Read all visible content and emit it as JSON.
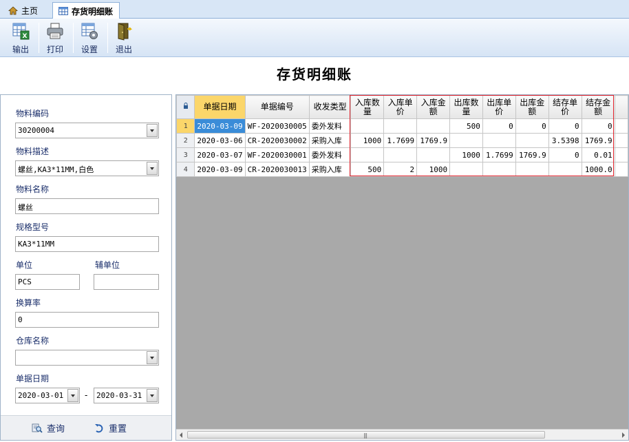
{
  "tabs": [
    {
      "label": "主页",
      "icon": "home-icon"
    },
    {
      "label": "存货明细账",
      "icon": "table-icon"
    }
  ],
  "toolbar": {
    "export_label": "输出",
    "print_label": "打印",
    "settings_label": "设置",
    "exit_label": "退出"
  },
  "report_title": "存货明细账",
  "form": {
    "material_code": {
      "label": "物料编码",
      "value": "30200004"
    },
    "material_desc": {
      "label": "物料描述",
      "value": "螺丝,KA3*11MM,白色"
    },
    "material_name": {
      "label": "物料名称",
      "value": "螺丝"
    },
    "spec_model": {
      "label": "规格型号",
      "value": "KA3*11MM"
    },
    "unit": {
      "label": "单位",
      "value": "PCS"
    },
    "aux_unit": {
      "label": "辅单位",
      "value": ""
    },
    "conversion_rate": {
      "label": "换算率",
      "value": "0"
    },
    "warehouse_name": {
      "label": "仓库名称",
      "value": ""
    },
    "doc_date": {
      "label": "单据日期",
      "from": "2020-03-01",
      "separator": "-",
      "to": "2020-03-31"
    }
  },
  "actions": {
    "query_label": "查询",
    "reset_label": "重置"
  },
  "grid": {
    "columns": [
      "单据日期",
      "单据编号",
      "收发类型",
      "入库数量",
      "入库单价",
      "入库金额",
      "出库数量",
      "出库单价",
      "出库金额",
      "结存单价",
      "结存金额"
    ],
    "column_lines": [
      [
        "单据日期"
      ],
      [
        "单据编号"
      ],
      [
        "收发类型"
      ],
      [
        "入库数",
        "量"
      ],
      [
        "入库单",
        "价"
      ],
      [
        "入库金",
        "额"
      ],
      [
        "出库数",
        "量"
      ],
      [
        "出库单",
        "价"
      ],
      [
        "出库金",
        "额"
      ],
      [
        "结存单",
        "价"
      ],
      [
        "结存金",
        "额"
      ]
    ],
    "rows": [
      {
        "n": "1",
        "cells": [
          "2020-03-09",
          "WF-2020030005",
          "委外发料",
          "",
          "",
          "",
          "500",
          "0",
          "0",
          "0",
          "0"
        ]
      },
      {
        "n": "2",
        "cells": [
          "2020-03-06",
          "CR-2020030002",
          "采购入库",
          "1000",
          "1.7699",
          "1769.9",
          "",
          "",
          "",
          "3.5398",
          "1769.9"
        ]
      },
      {
        "n": "3",
        "cells": [
          "2020-03-07",
          "WF-2020030001",
          "委外发料",
          "",
          "",
          "",
          "1000",
          "1.7699",
          "1769.9",
          "0",
          "0.01"
        ]
      },
      {
        "n": "4",
        "cells": [
          "2020-03-09",
          "CR-2020030013",
          "采购入库",
          "500",
          "2",
          "1000",
          "",
          "",
          "",
          "",
          "1000.0"
        ]
      }
    ],
    "scroll_grip": "|||"
  },
  "colors": {
    "selected_header": "#fbd66a",
    "selected_cell": "#3a8cd8",
    "highlight_box": "#e0202a"
  }
}
